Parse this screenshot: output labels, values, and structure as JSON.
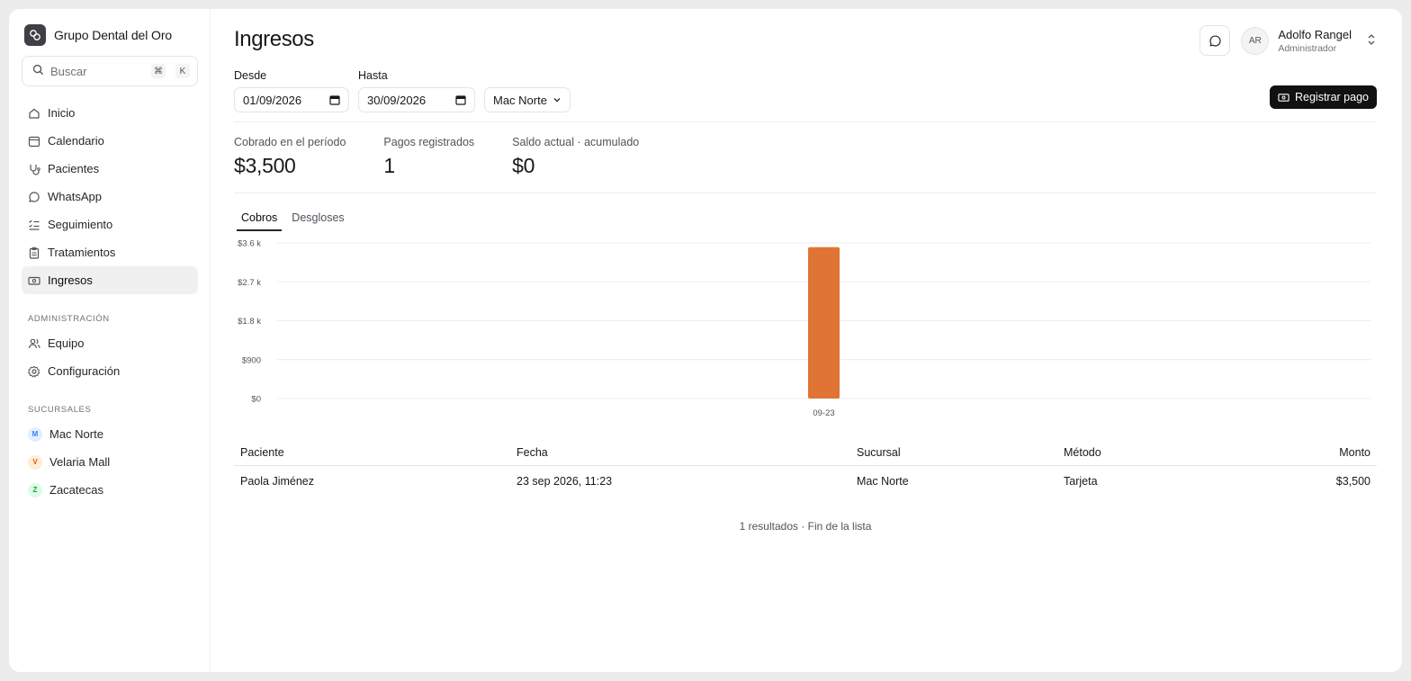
{
  "app": {
    "name": "Grupo Dental del Oro"
  },
  "search": {
    "placeholder": "Buscar",
    "kbd1": "⌘",
    "kbd2": "K"
  },
  "nav": {
    "items": [
      {
        "label": "Inicio",
        "icon": "home-icon"
      },
      {
        "label": "Calendario",
        "icon": "calendar-icon"
      },
      {
        "label": "Pacientes",
        "icon": "stethoscope-icon"
      },
      {
        "label": "WhatsApp",
        "icon": "chat-icon"
      },
      {
        "label": "Seguimiento",
        "icon": "list-check-icon"
      },
      {
        "label": "Tratamientos",
        "icon": "clipboard-icon"
      },
      {
        "label": "Ingresos",
        "icon": "banknote-icon",
        "active": true
      }
    ],
    "admin_label": "ADMINISTRACIÓN",
    "admin_items": [
      {
        "label": "Equipo",
        "icon": "users-icon"
      },
      {
        "label": "Configuración",
        "icon": "gear-icon"
      }
    ],
    "branches_label": "SUCURSALES",
    "branches": [
      {
        "initial": "M",
        "label": "Mac Norte",
        "color": "#3b82f6",
        "bg": "#e0efff"
      },
      {
        "initial": "V",
        "label": "Velaria Mall",
        "color": "#ea580c",
        "bg": "#ffedd5"
      },
      {
        "initial": "Z",
        "label": "Zacatecas",
        "color": "#16a34a",
        "bg": "#dcfce7"
      }
    ]
  },
  "header": {
    "title": "Ingresos",
    "user": {
      "initials": "AR",
      "name": "Adolfo Rangel",
      "role": "Administrador"
    }
  },
  "filters": {
    "from_label": "Desde",
    "from_value": "01/09/2026",
    "to_label": "Hasta",
    "to_value": "30/09/2026",
    "branch_value": "Mac Norte"
  },
  "actions": {
    "register_payment": "Registrar pago"
  },
  "stats": [
    {
      "label": "Cobrado en el período",
      "value": "$3,500"
    },
    {
      "label": "Pagos registrados",
      "value": "1"
    },
    {
      "label": "Saldo actual · acumulado",
      "value": "$0"
    }
  ],
  "tabs": [
    {
      "label": "Cobros",
      "active": true
    },
    {
      "label": "Desgloses"
    }
  ],
  "chart_data": {
    "type": "bar",
    "categories": [
      "09-23"
    ],
    "values": [
      3500
    ],
    "ylim": [
      0,
      3600
    ],
    "yticks": [
      0,
      900,
      1800,
      2700,
      3600
    ],
    "ytick_labels": [
      "$0",
      "$900",
      "$1.8 k",
      "$2.7 k",
      "$3.6 k"
    ],
    "grid": true,
    "bar_color": "#e07434",
    "x_position_fraction": 0.5
  },
  "table": {
    "headers": [
      "Paciente",
      "Fecha",
      "Sucursal",
      "Método",
      "Monto"
    ],
    "rows": [
      [
        "Paola Jiménez",
        "23 sep 2026, 11:23",
        "Mac Norte",
        "Tarjeta",
        "$3,500"
      ]
    ],
    "footer": "1 resultados · Fin de la lista"
  }
}
